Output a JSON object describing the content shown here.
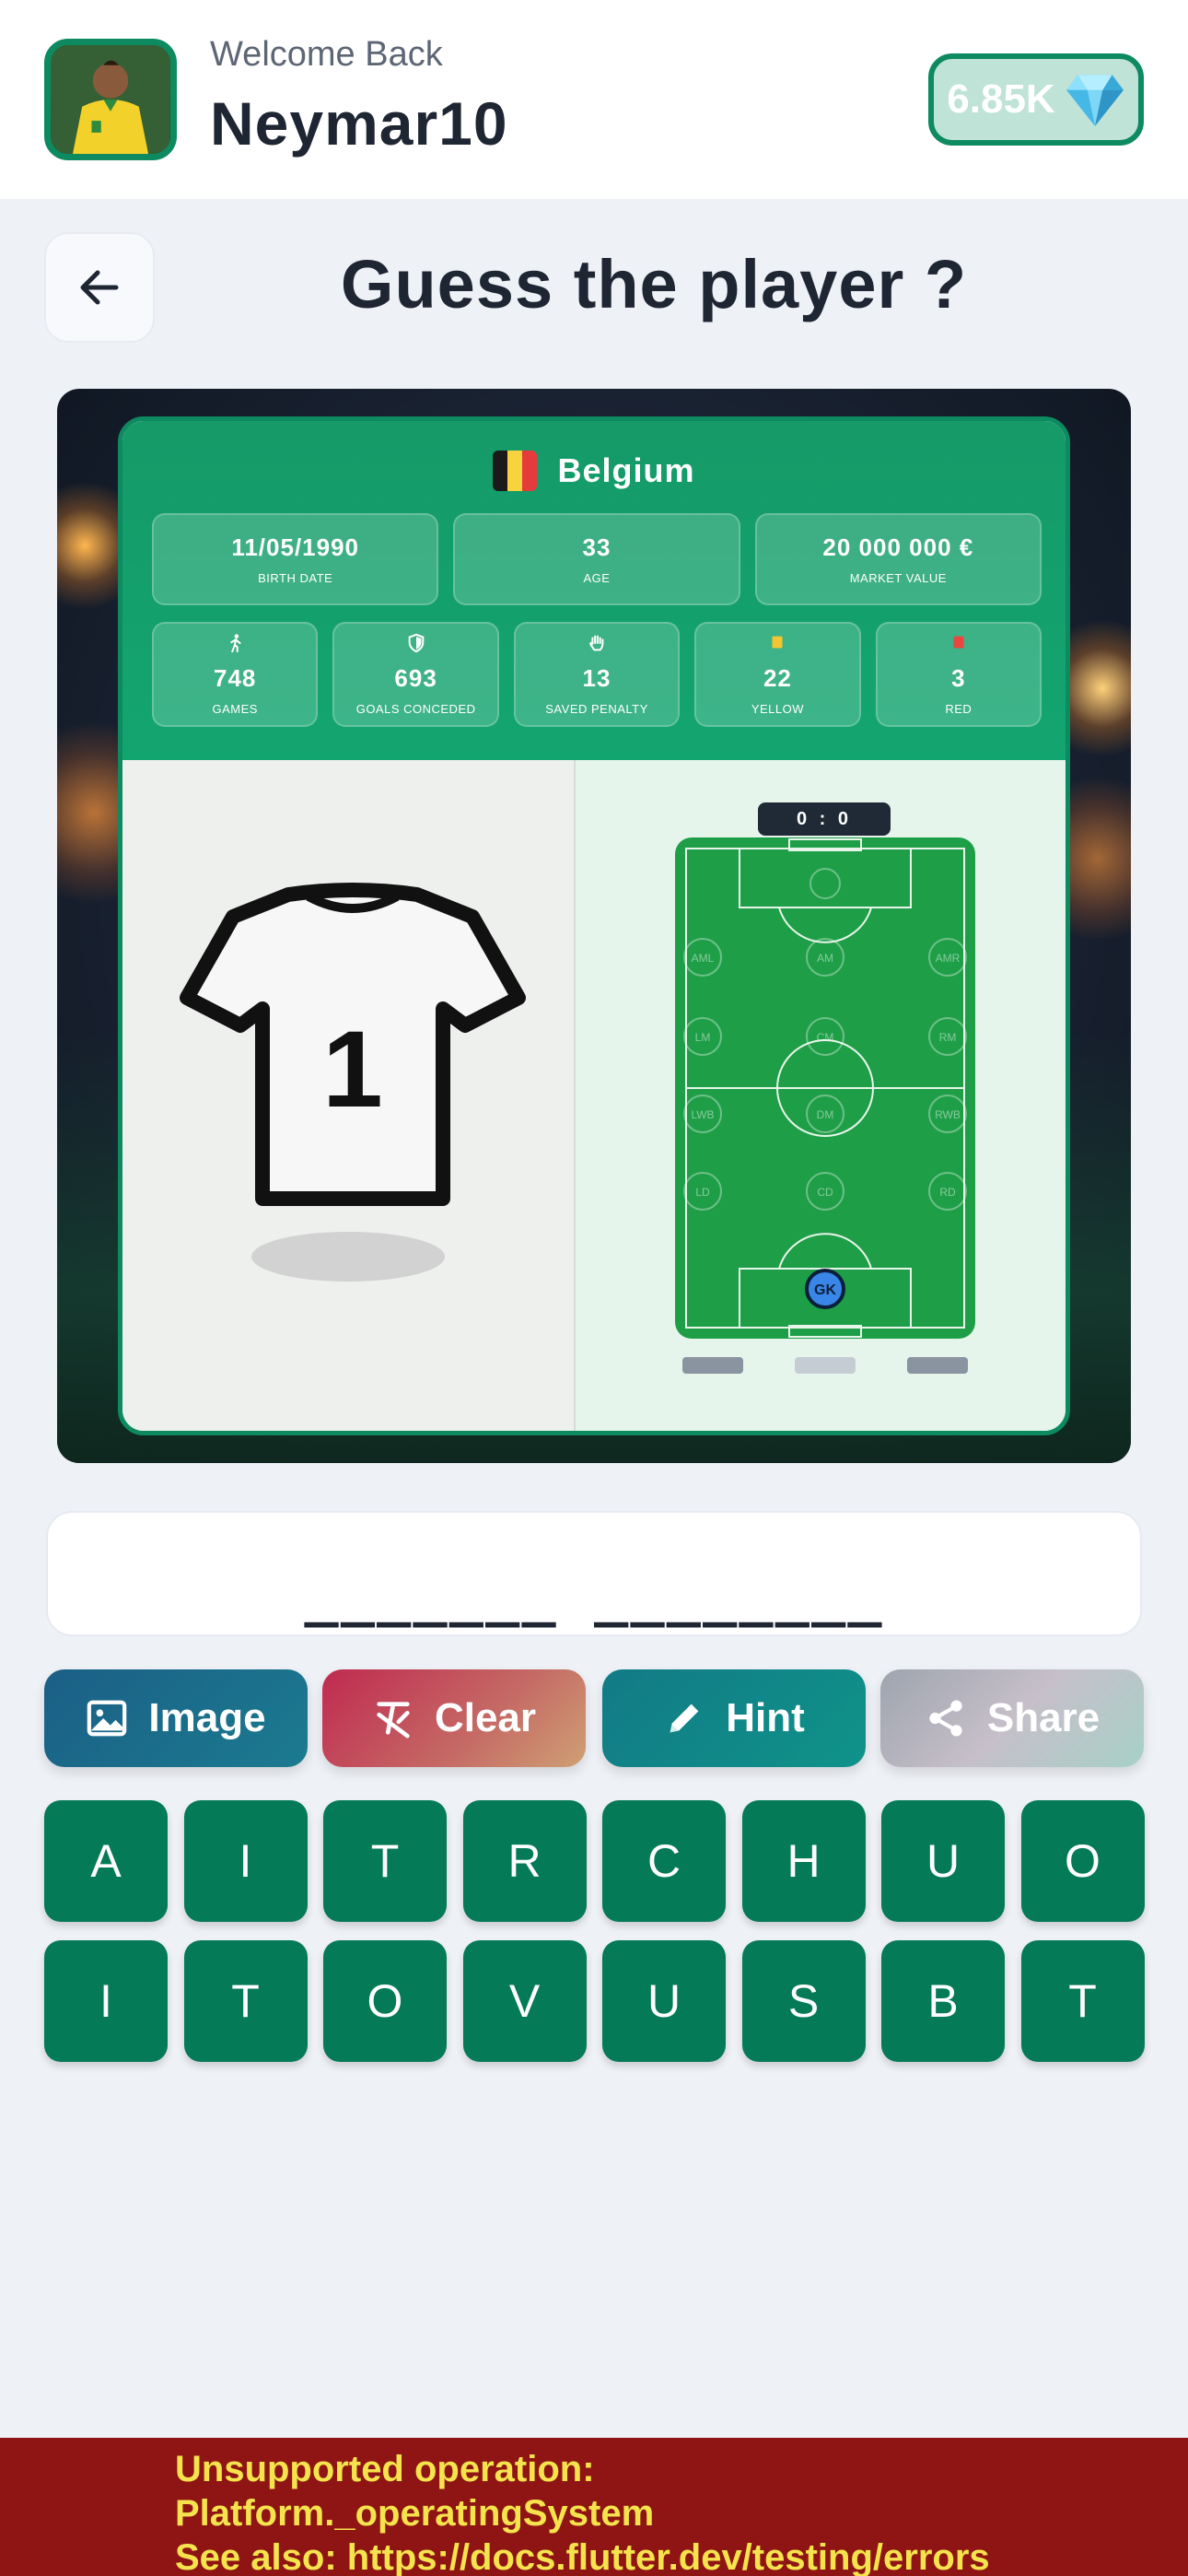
{
  "header": {
    "welcome": "Welcome Back",
    "username": "Neymar10",
    "gems": "6.85K",
    "avatar_icon": "player-avatar",
    "gem_icon": "diamond-icon"
  },
  "page": {
    "title": "Guess the player ?",
    "back_icon": "arrow-left-icon"
  },
  "player_card": {
    "country": "Belgium",
    "flag_colors": [
      "#1a1a1a",
      "#f7d33d",
      "#e53b3b"
    ],
    "stats_top": [
      {
        "value": "11/05/1990",
        "label": "BIRTH DATE"
      },
      {
        "value": "33",
        "label": "AGE"
      },
      {
        "value": "20 000 000 €",
        "label": "MARKET VALUE"
      }
    ],
    "stats_bottom": [
      {
        "icon": "running-icon",
        "value": "748",
        "label": "GAMES"
      },
      {
        "icon": "shield-icon",
        "value": "693",
        "label": "GOALS CONCEDED"
      },
      {
        "icon": "hand-icon",
        "value": "13",
        "label": "SAVED PENALTY"
      },
      {
        "icon": "yellow-card-icon",
        "value": "22",
        "label": "YELLOW"
      },
      {
        "icon": "red-card-icon",
        "value": "3",
        "label": "RED"
      }
    ],
    "jersey_number": "1",
    "score": "0 : 0",
    "positions": [
      "AML",
      "AM",
      "AMR",
      "LM",
      "CM",
      "RM",
      "LWB",
      "DM",
      "RWB",
      "LD",
      "CD",
      "RD"
    ],
    "player_position": "GK"
  },
  "answer": {
    "masked": "_______ ________"
  },
  "actions": {
    "image": "Image",
    "clear": "Clear",
    "hint": "Hint",
    "share": "Share"
  },
  "letters": {
    "row1": [
      "A",
      "I",
      "T",
      "R",
      "C",
      "H",
      "U",
      "O"
    ],
    "row2": [
      "I",
      "T",
      "O",
      "V",
      "U",
      "S",
      "B",
      "T"
    ]
  },
  "error": {
    "message": "Unsupported operation:\nPlatform._operatingSystem\nSee also: https://docs.flutter.dev/testing/errors"
  },
  "colors": {
    "primary": "#047a56",
    "accent": "#0d8a5f",
    "error_bg": "#8f1414",
    "error_text": "#f4e34c"
  }
}
